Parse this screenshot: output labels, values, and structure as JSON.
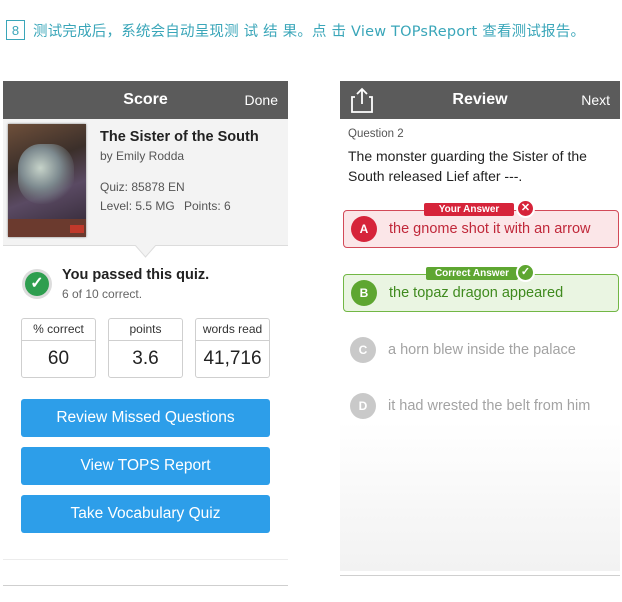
{
  "caption": {
    "step": "8",
    "text": "测试完成后，系统会自动呈现测 试 结 果。点 击 View TOPsReport 查看测试报告。"
  },
  "score_screen": {
    "title": "Score",
    "done_label": "Done",
    "book": {
      "title": "The Sister of the South",
      "author": "by Emily Rodda",
      "quiz": "Quiz: 85878 EN",
      "level": "Level: 5.5 MG",
      "points": "Points: 6"
    },
    "result": {
      "headline": "You passed this quiz.",
      "detail": "6 of 10 correct."
    },
    "stats": [
      {
        "label": "% correct",
        "value": "60"
      },
      {
        "label": "points",
        "value": "3.6"
      },
      {
        "label": "words read",
        "value": "41,716"
      }
    ],
    "buttons": {
      "review_missed": "Review Missed Questions",
      "view_tops": "View TOPS Report",
      "take_vocab": "Take Vocabulary Quiz"
    }
  },
  "review_screen": {
    "title": "Review",
    "next_label": "Next",
    "share_icon": "share-icon",
    "question_label": "Question 2",
    "question_text": "The monster guarding the Sister of the South released Lief after ---.",
    "your_answer_tag": "Your Answer",
    "correct_answer_tag": "Correct Answer",
    "answers": [
      {
        "letter": "A",
        "text": "the gnome shot it with an arrow"
      },
      {
        "letter": "B",
        "text": "the topaz dragon appeared"
      },
      {
        "letter": "C",
        "text": "a horn blew inside the palace"
      },
      {
        "letter": "D",
        "text": "it had wrested the belt from him"
      }
    ],
    "colors": {
      "wrong": "#d6243a",
      "correct": "#5ea631",
      "button": "#2d9ee9",
      "topbar": "#5b5b5b"
    }
  }
}
